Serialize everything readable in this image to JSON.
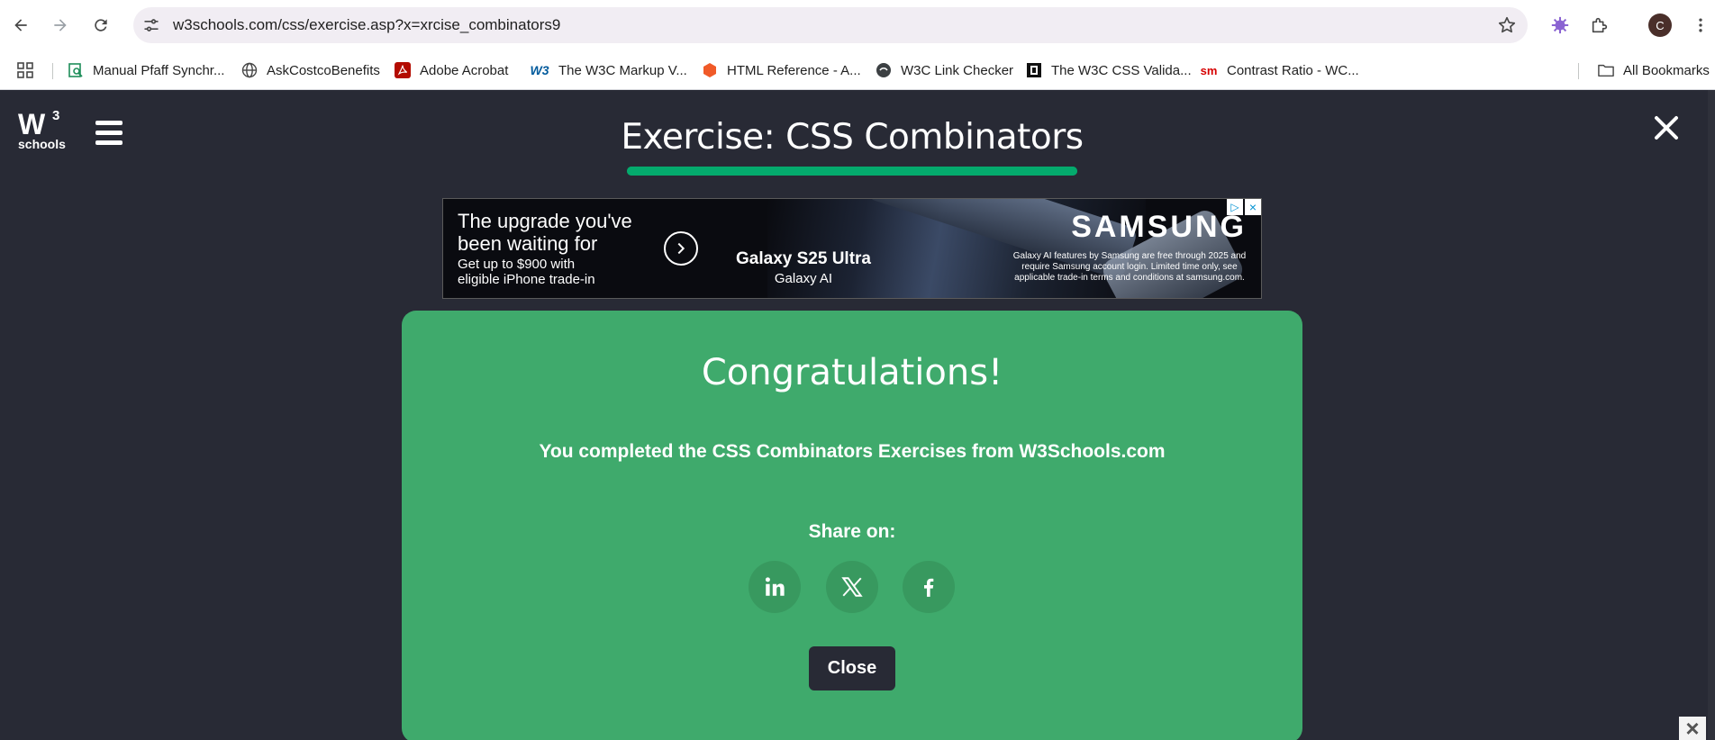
{
  "browser": {
    "url": "w3schools.com/css/exercise.asp?x=xrcise_combinators9",
    "profile_initial": "C",
    "icons": [
      "back-icon",
      "forward-icon",
      "reload-icon",
      "tune-icon",
      "star-icon",
      "extension-puzzle-icon",
      "gemini-icon",
      "kebab-menu-icon"
    ]
  },
  "bookmarks": {
    "items": [
      {
        "label": "Manual Pfaff Synchr...",
        "icon": "search-doc-icon"
      },
      {
        "label": "AskCostcoBenefits",
        "icon": "globe-icon"
      },
      {
        "label": "Adobe Acrobat",
        "icon": "acrobat-icon"
      },
      {
        "label": "The W3C Markup V...",
        "icon": "w3c-icon"
      },
      {
        "label": "HTML Reference - A...",
        "icon": "html-ref-icon"
      },
      {
        "label": "W3C Link Checker",
        "icon": "link-checker-icon"
      },
      {
        "label": "The W3C CSS Valida...",
        "icon": "css-validator-icon"
      },
      {
        "label": "Contrast Ratio - WC...",
        "icon": "sm-icon",
        "badge": "sm"
      }
    ],
    "all_bookmarks": "All Bookmarks",
    "w3c_badge": "W3"
  },
  "logo": {
    "w": "W",
    "sup": "3",
    "sub": "schools"
  },
  "exercise": {
    "title": "Exercise: CSS Combinators",
    "progress": 1.0,
    "accent": "#04AA6D"
  },
  "ad": {
    "headline": "The upgrade you've been waiting for",
    "sub": "Get up to $900 with eligible iPhone trade-in",
    "model": "Galaxy S25 Ultra",
    "ai": "Galaxy AI",
    "brand": "SAMSUNG",
    "fine_print": "Galaxy AI features by Samsung are free through 2025 and require Samsung account login. Limited time only, see applicable trade-in terms and conditions at samsung.com."
  },
  "modal": {
    "heading": "Congratulations!",
    "message": "You completed the CSS Combinators Exercises from W3Schools.com",
    "share_label": "Share on:",
    "close_label": "Close",
    "background": "#3FAA6C"
  }
}
